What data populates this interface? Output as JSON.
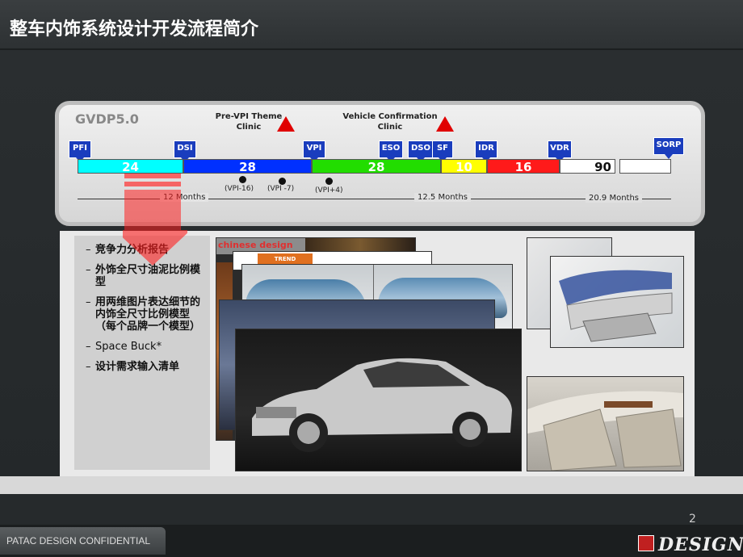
{
  "title": "整车内饰系统设计开发流程简介",
  "timeline": {
    "name": "GVDP5.0",
    "callouts": [
      {
        "label": "Pre-VPI Theme\nClinic"
      },
      {
        "label": "Vehicle Confirmation\nClinic"
      }
    ],
    "gates": [
      "PFI",
      "DSI",
      "VPI",
      "ESO",
      "DSO",
      "SF",
      "IDR",
      "VDR",
      "SORP"
    ],
    "segments": [
      {
        "value": "24",
        "color": "#00ffff"
      },
      {
        "value": "28",
        "color": "#0030ff"
      },
      {
        "value": "28",
        "color": "#22dd00"
      },
      {
        "value": "10",
        "color": "#ffff00"
      },
      {
        "value": "16",
        "color": "#ff1a1a"
      },
      {
        "value": "90",
        "color": "#ffffff"
      }
    ],
    "sub_markers": [
      "(VPI-16)",
      "(VPI -7)",
      "(VPI+4)"
    ],
    "durations": [
      "12 Months",
      "12.5 Months",
      "20.9 Months"
    ]
  },
  "bullets": [
    "竞争力分析报告",
    "外饰全尺寸油泥比例模型",
    "用两维图片表达细节的内饰全尺寸比例模型（每个品牌一个模型）",
    "Space Buck*",
    "设计需求输入清单"
  ],
  "photo_labels": {
    "magazine": "chinese design",
    "trend": "TREND"
  },
  "footer": {
    "confidential": "PATAC DESIGN CONFIDENTIAL",
    "page_number": "2",
    "logo": "DESIGN"
  },
  "colors": {
    "gate_blue": "#1a3dbd",
    "triangle_red": "#e00000",
    "arrow_red": "#ff2020"
  }
}
